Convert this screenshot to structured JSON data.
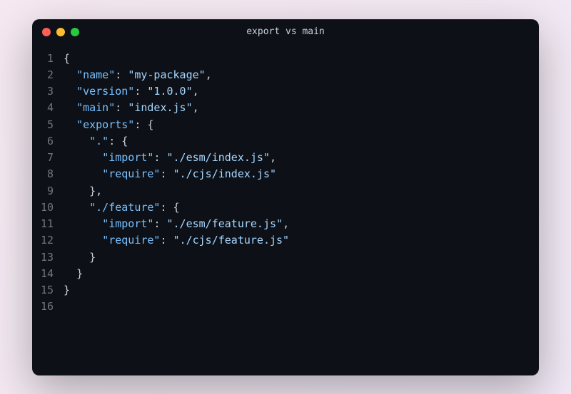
{
  "window": {
    "title": "export vs main"
  },
  "lines": {
    "l1": {
      "num": "1",
      "p1": "{"
    },
    "l2": {
      "num": "2",
      "ind": "  ",
      "k": "\"name\"",
      "c": ": ",
      "v": "\"my-package\"",
      "t": ","
    },
    "l3": {
      "num": "3",
      "ind": "  ",
      "k": "\"version\"",
      "c": ": ",
      "v": "\"1.0.0\"",
      "t": ","
    },
    "l4": {
      "num": "4",
      "ind": "  ",
      "k": "\"main\"",
      "c": ": ",
      "v": "\"index.js\"",
      "t": ","
    },
    "l5": {
      "num": "5",
      "ind": "  ",
      "k": "\"exports\"",
      "c": ": ",
      "p": "{"
    },
    "l6": {
      "num": "6",
      "ind": "    ",
      "k": "\".\"",
      "c": ": ",
      "p": "{"
    },
    "l7": {
      "num": "7",
      "ind": "      ",
      "k": "\"import\"",
      "c": ": ",
      "v": "\"./esm/index.js\"",
      "t": ","
    },
    "l8": {
      "num": "8",
      "ind": "      ",
      "k": "\"require\"",
      "c": ": ",
      "v": "\"./cjs/index.js\""
    },
    "l9": {
      "num": "9",
      "ind": "    ",
      "p": "},",
      "t": ""
    },
    "l10": {
      "num": "10",
      "ind": "    ",
      "k": "\"./feature\"",
      "c": ": ",
      "p": "{"
    },
    "l11": {
      "num": "11",
      "ind": "      ",
      "k": "\"import\"",
      "c": ": ",
      "v": "\"./esm/feature.js\"",
      "t": ","
    },
    "l12": {
      "num": "12",
      "ind": "      ",
      "k": "\"require\"",
      "c": ": ",
      "v": "\"./cjs/feature.js\""
    },
    "l13": {
      "num": "13",
      "ind": "    ",
      "p": "}"
    },
    "l14": {
      "num": "14",
      "ind": "  ",
      "p": "}"
    },
    "l15": {
      "num": "15",
      "p": "}"
    },
    "l16": {
      "num": "16"
    }
  }
}
